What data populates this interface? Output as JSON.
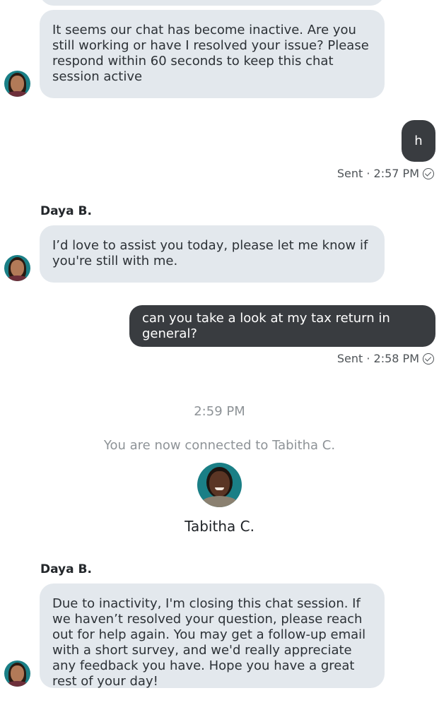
{
  "messages": {
    "msg1": "It seems our chat has become inactive. Are you still working or have I resolved your issue? Please respond within 60 seconds to keep this chat session active",
    "out1": "h",
    "out1_status": "Sent · 2:57 PM",
    "sender2": "Daya B.",
    "msg2": "I’d love to assist you today, please let me know if you're still with me.",
    "out2": "can you take a look at my tax return in general?",
    "out2_status": "Sent · 2:58 PM",
    "timestamp": "2:59 PM",
    "system_notice": "You are now connected to Tabitha C.",
    "agent_name": "Tabitha C.",
    "sender3": "Daya B.",
    "msg3": "Due to inactivity, I'm closing this chat session. If we haven’t resolved your question, please reach out for help again. You may get a follow-up email with a short survey, and we'd really appreciate any feedback you have. Hope you have a great rest of your day!"
  },
  "icons": {
    "status": "check-circle-icon"
  },
  "colors": {
    "incoming_bubble": "#e3e8ed",
    "outgoing_bubble": "#393c40",
    "avatar_bg": "#1a7f86"
  }
}
